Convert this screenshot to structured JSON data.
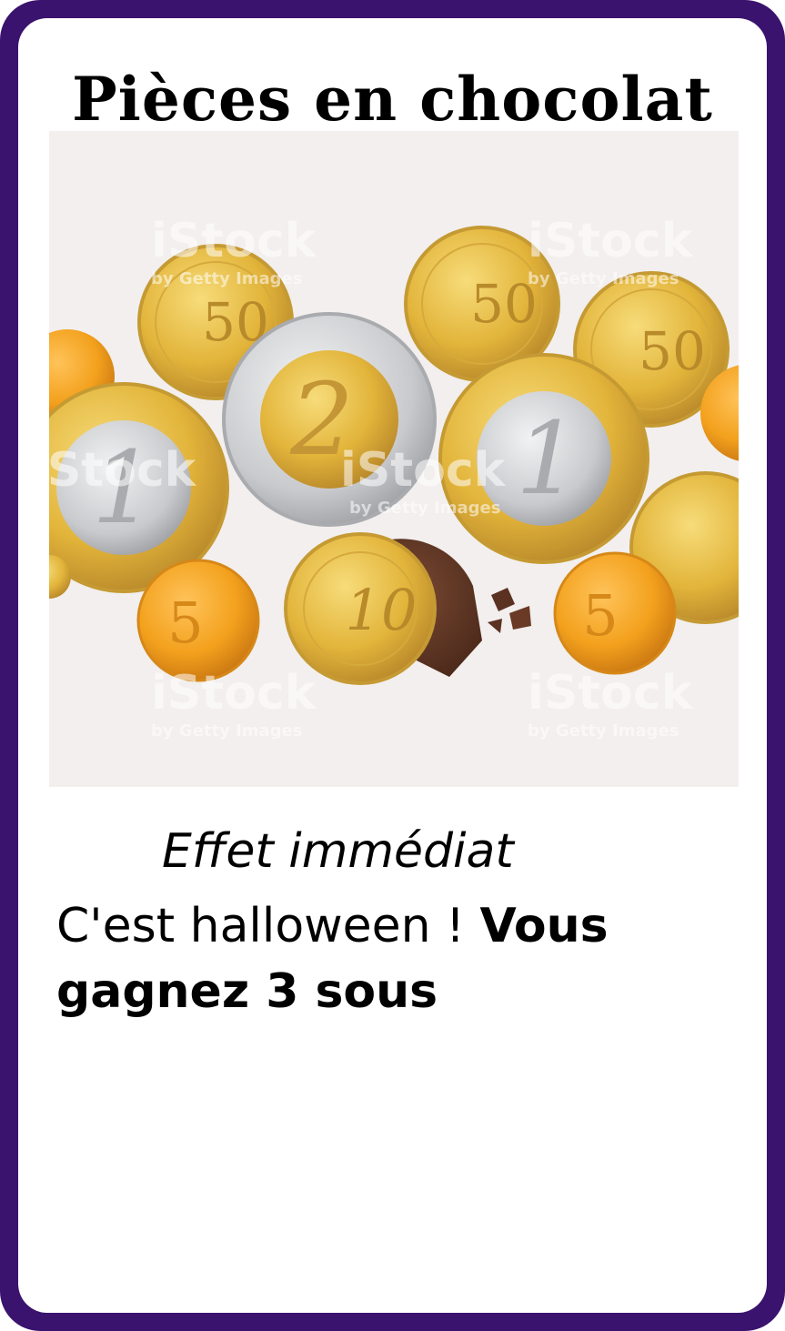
{
  "card": {
    "title": "Pièces en chocolat",
    "effect_label": "Effet immédiat",
    "effect_text_plain": "C'est halloween ! ",
    "effect_text_bold": "Vous gagnez 3 sous",
    "image": {
      "subject": "chocolate-coins",
      "watermark_brand": "iStock",
      "watermark_sub": "by Getty Images",
      "coin_numerals": [
        "50",
        "2",
        "1",
        "50",
        "1",
        "5",
        "10",
        "5",
        "50"
      ]
    }
  },
  "colors": {
    "frame": "#3a136e",
    "background": "#ffffff",
    "gold": "#e5b83a",
    "silver": "#cfd0d2",
    "copper": "#f2a21c",
    "chocolate": "#5b3122"
  }
}
